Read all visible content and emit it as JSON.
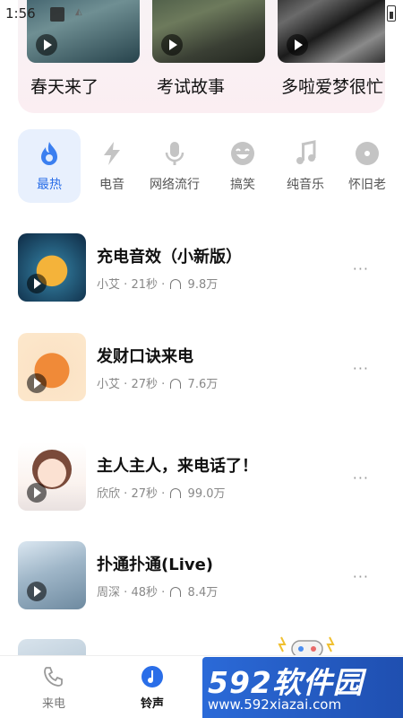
{
  "status_bar": {
    "time": "1:56"
  },
  "videos": [
    {
      "title": "春天来了"
    },
    {
      "title": "考试故事"
    },
    {
      "title": "多啦爱梦很忙"
    }
  ],
  "categories": [
    {
      "label": "最热",
      "icon": "flame-icon",
      "active": true
    },
    {
      "label": "电音",
      "icon": "lightning-icon"
    },
    {
      "label": "网络流行",
      "icon": "microphone-icon"
    },
    {
      "label": "搞笑",
      "icon": "laughing-face-icon"
    },
    {
      "label": "纯音乐",
      "icon": "music-note-icon"
    },
    {
      "label": "怀旧老",
      "icon": "vinyl-disc-icon"
    }
  ],
  "ringtones": [
    {
      "title": "充电音效（小新版）",
      "author": "小艾",
      "duration": "21秒",
      "plays": "9.8万"
    },
    {
      "title": "发财口诀来电",
      "author": "小艾",
      "duration": "27秒",
      "plays": "7.6万"
    },
    {
      "title": "主人主人，来电话了！",
      "author": "欣欣",
      "duration": "27秒",
      "plays": "99.0万"
    },
    {
      "title": "扑通扑通(Live)",
      "author": "周深",
      "duration": "48秒",
      "plays": "8.4万"
    }
  ],
  "meta_separator": "·",
  "more_symbol": "···",
  "bottom_nav": [
    {
      "label": "来电",
      "icon": "phone-call-icon"
    },
    {
      "label": "铃声",
      "icon": "music-note-icon",
      "active": true
    }
  ],
  "watermark": {
    "brand": "592软件园",
    "url": "www.592xiazai.com"
  },
  "colors": {
    "accent": "#2a6ee8",
    "active_bg": "#e8f0fd",
    "meta": "#888888"
  }
}
